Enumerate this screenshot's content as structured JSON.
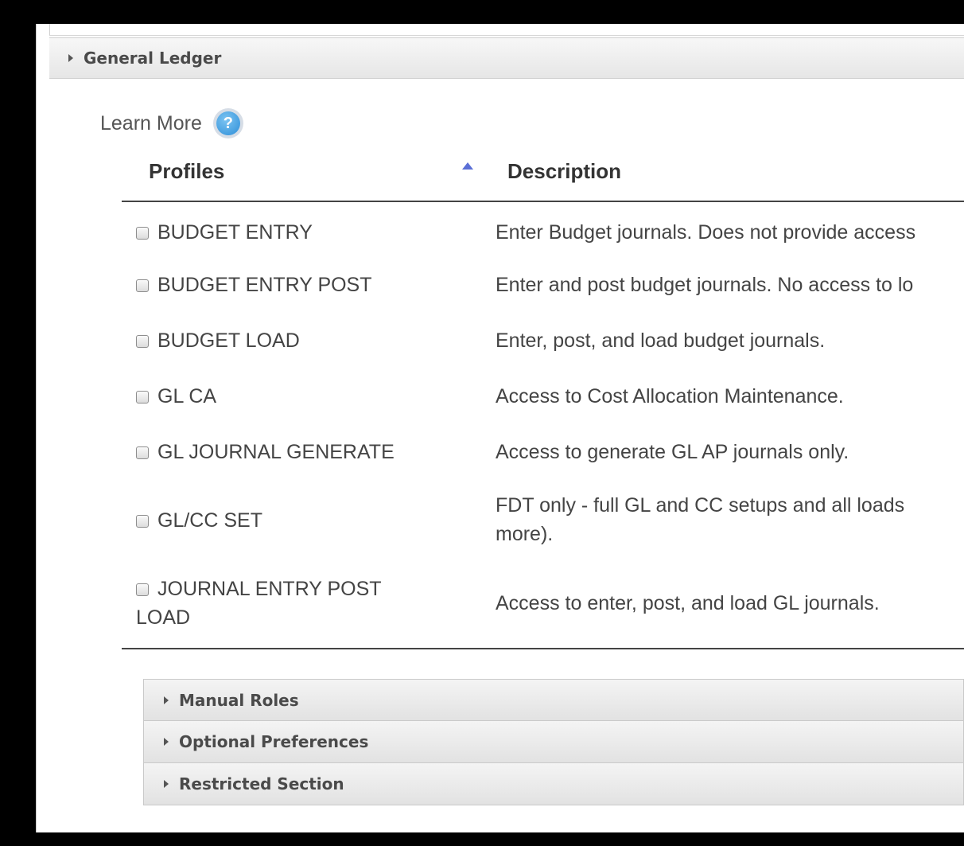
{
  "section": {
    "title": "General Ledger"
  },
  "learn_more": {
    "label": "Learn More",
    "icon_glyph": "?"
  },
  "table": {
    "headers": {
      "profiles": "Profiles",
      "description": "Description"
    },
    "sort": {
      "column": "profiles",
      "direction": "ascending",
      "icon": "sort-asc-icon",
      "color": "#5b6fd6"
    },
    "rows": [
      {
        "profile": "BUDGET ENTRY",
        "description": "Enter Budget journals. Does not provide access",
        "checked": false
      },
      {
        "profile": "BUDGET ENTRY POST",
        "description": "Enter and post budget journals. No access to lo",
        "checked": false
      },
      {
        "profile": "BUDGET LOAD",
        "description": "Enter, post, and load budget journals.",
        "checked": false
      },
      {
        "profile": "GL CA",
        "description": "Access to Cost Allocation Maintenance.",
        "checked": false
      },
      {
        "profile": "GL JOURNAL GENERATE",
        "description": "Access to generate GL AP journals only.",
        "checked": false
      },
      {
        "profile": "GL/CC SET",
        "description": "FDT only - full GL and CC setups and all loads more).",
        "checked": false
      },
      {
        "profile": "JOURNAL ENTRY POST LOAD",
        "description": "Access to enter, post, and load GL journals.",
        "checked": false
      }
    ]
  },
  "subsections": [
    {
      "title": "Manual Roles"
    },
    {
      "title": "Optional Preferences"
    },
    {
      "title": "Restricted Section"
    }
  ]
}
